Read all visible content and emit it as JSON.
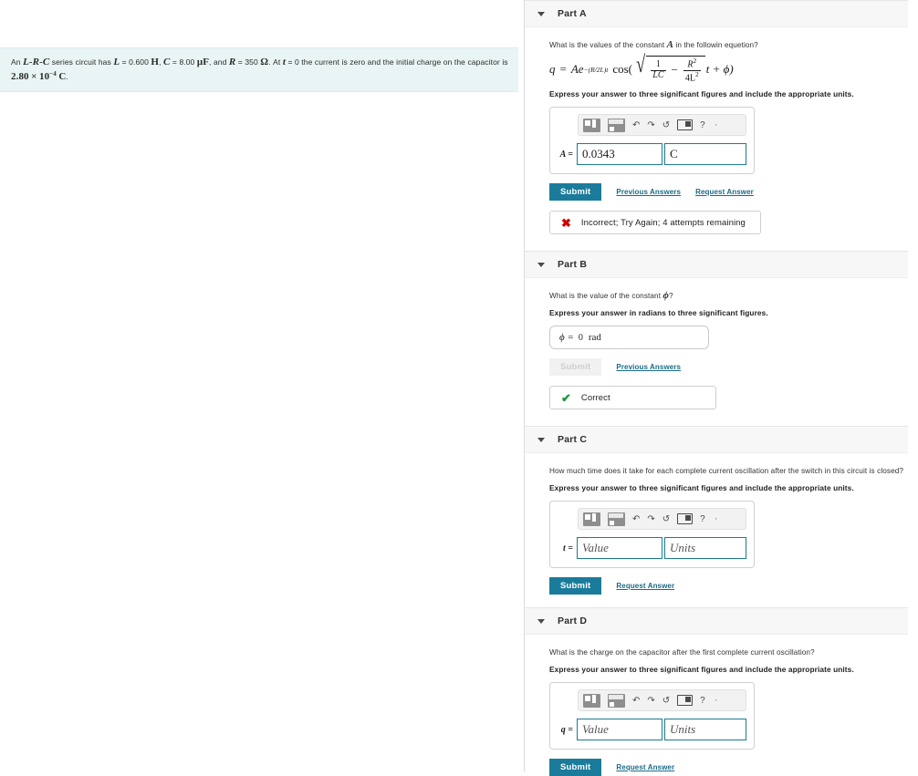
{
  "problem": {
    "text_segments": {
      "s1": "An ",
      "var_lrc": "L-R-C",
      "s2": " series circuit has ",
      "var_L": "L",
      "eq1": " = ",
      "val_L": "0.600",
      "unit_L": "H",
      "sep1": ", ",
      "var_C": "C",
      "val_C": "8.00",
      "unit_C": "μF",
      "sep2": ", and ",
      "var_R": "R",
      "val_R": "350",
      "unit_R": "Ω",
      "s3": ". At ",
      "var_t": "t",
      "val_t": "0",
      "s4": " the current is zero and the initial charge on the capacitor is ",
      "val_q": "2.80",
      "times": "×",
      "base": "10",
      "exponent": "−4",
      "unit_q": "C",
      "period": "."
    }
  },
  "parts": [
    {
      "id": "part-a",
      "title": "Part A",
      "prompt_pre": "What is the values of the constant ",
      "prompt_var": "A",
      "prompt_post": " in the followin equetion?",
      "has_equation": true,
      "equation": {
        "lhs": "q",
        "equals": "=",
        "amplitude": "A",
        "exp_base": "e",
        "exp_power": "−(R/2L)t",
        "cos": "cos(",
        "frac1_num": "1",
        "frac1_den": "LC",
        "minus": "−",
        "frac2_num": "R",
        "frac2_num_sup": "2",
        "frac2_den": "4L",
        "frac2_den_sup": "2",
        "tail": "t + ϕ)"
      },
      "instruction": "Express your answer to three significant figures and include the appropriate units.",
      "widget": "math",
      "var_label": "A =",
      "value": "0.0343",
      "units": "C",
      "value_placeholder": "Value",
      "units_placeholder": "Units",
      "submit_label": "Submit",
      "submit_disabled": false,
      "links": [
        "Previous Answers",
        "Request Answer"
      ],
      "feedback": {
        "type": "incorrect",
        "icon": "✖",
        "text": "Incorrect; Try Again; 4 attempts remaining"
      }
    },
    {
      "id": "part-b",
      "title": "Part B",
      "prompt_pre": "What is the value of the constant ",
      "prompt_var": "ϕ",
      "prompt_post": "?",
      "has_equation": false,
      "instruction": "Express your answer in radians to three significant figures.",
      "widget": "simple",
      "var_label": "ϕ =",
      "value": "0",
      "units": "rad",
      "submit_label": "Submit",
      "submit_disabled": true,
      "links": [
        "Previous Answers"
      ],
      "feedback": {
        "type": "correct",
        "icon": "✔",
        "text": "Correct"
      }
    },
    {
      "id": "part-c",
      "title": "Part C",
      "prompt_pre": "How much time does it take for each complete current oscillation after the switch in this circuit is closed?",
      "prompt_var": "",
      "prompt_post": "",
      "has_equation": false,
      "instruction": "Express your answer to three significant figures and include the appropriate units.",
      "widget": "math",
      "var_label": "t =",
      "value": "",
      "units": "",
      "value_placeholder": "Value",
      "units_placeholder": "Units",
      "submit_label": "Submit",
      "submit_disabled": false,
      "links": [
        "Request Answer"
      ],
      "feedback": null
    },
    {
      "id": "part-d",
      "title": "Part D",
      "prompt_pre": "What is the charge on the capacitor after the first complete current oscillation?",
      "prompt_var": "",
      "prompt_post": "",
      "has_equation": false,
      "instruction": "Express your answer to three significant figures and include the appropriate units.",
      "widget": "math",
      "var_label": "q =",
      "value": "",
      "units": "",
      "value_placeholder": "Value",
      "units_placeholder": "Units",
      "submit_label": "Submit",
      "submit_disabled": false,
      "links": [
        "Request Answer"
      ],
      "feedback": null
    }
  ],
  "toolbar": {
    "icons": [
      "template-icon",
      "template-matrix-icon",
      "undo-icon",
      "redo-icon",
      "reset-icon",
      "keyboard-icon",
      "help-icon",
      "more-icon"
    ],
    "undo": "↶",
    "redo": "↷",
    "reset": "↺",
    "help": "?",
    "more": "·"
  },
  "colors": {
    "accent": "#1a7b9b",
    "link": "#1a6b86",
    "field_border": "#1c7b92",
    "incorrect": "#cc0000",
    "correct": "#1a9a3c",
    "question_bg": "#e8f5f4",
    "header_bg": "#f7f7f7"
  }
}
